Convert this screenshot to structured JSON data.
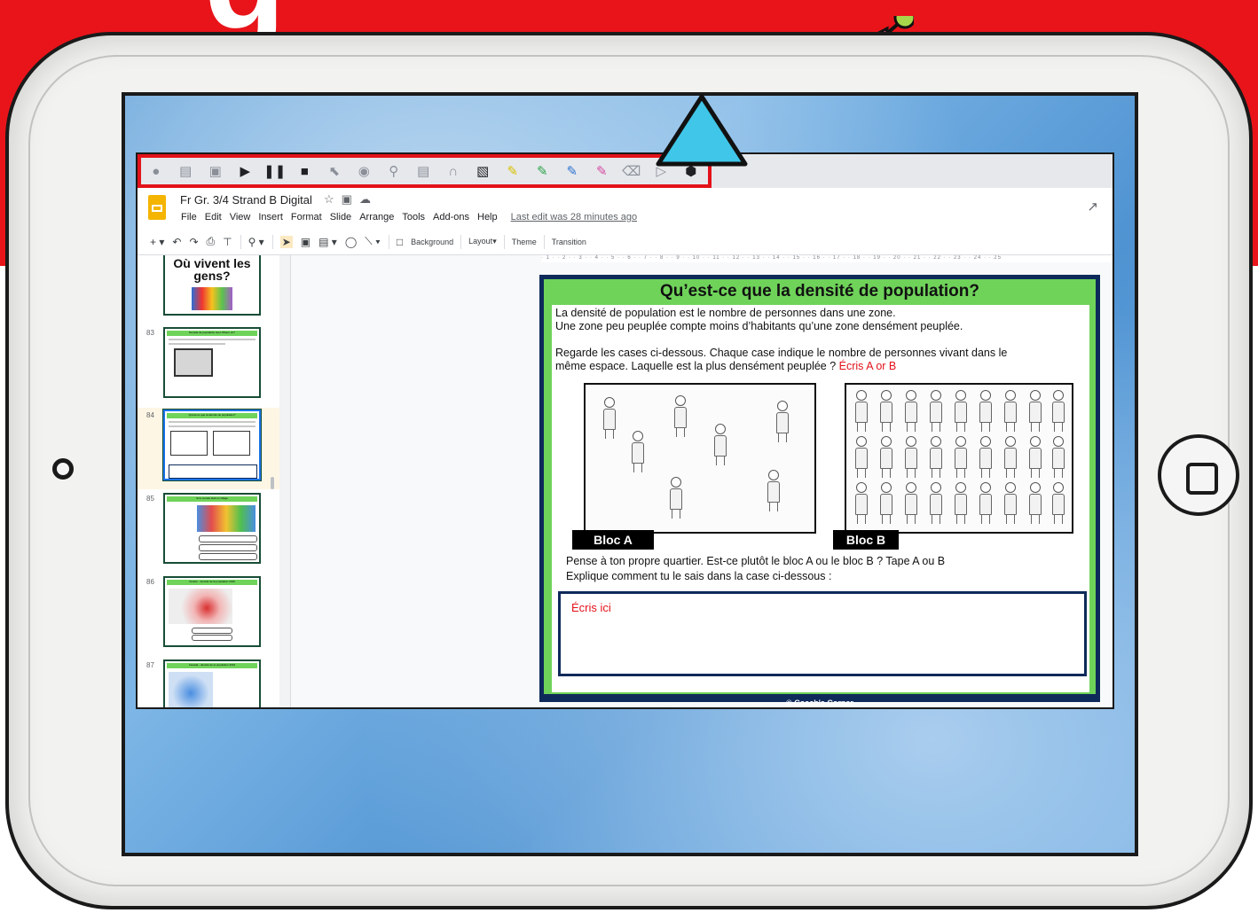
{
  "extension_toolbar": {
    "icons": [
      "speaker-icon",
      "book-icon",
      "image-icon",
      "play-icon",
      "pause-icon",
      "stop-icon",
      "select-icon",
      "speech-icon",
      "search-icon",
      "screen-icon",
      "headphones-icon",
      "translate-icon",
      "highlighter-yellow-icon",
      "highlighter-green-icon",
      "highlighter-blue-icon",
      "highlighter-pink-icon",
      "eraser-icon",
      "next-icon",
      "cube-icon"
    ]
  },
  "doc": {
    "title": "Fr Gr. 3/4 Strand B Digital",
    "menu": [
      "File",
      "Edit",
      "View",
      "Insert",
      "Format",
      "Slide",
      "Arrange",
      "Tools",
      "Add-ons",
      "Help"
    ],
    "last_edit": "Last edit was 28 minutes ago"
  },
  "toolbar": {
    "background": "Background",
    "layout": "Layout",
    "theme": "Theme",
    "transition": "Transition"
  },
  "filmstrip": {
    "first_title": "Où vivent les gens?",
    "slides": [
      {
        "num": "83",
        "title": "Densité de population avec Where on?"
      },
      {
        "num": "84",
        "title": "Qu'est-ce que la densité de population?"
      },
      {
        "num": "85",
        "title": "Si le monde était un village"
      },
      {
        "num": "86",
        "title": "Ontario - densité de la population 2016"
      },
      {
        "num": "87",
        "title": "Canada - densité de la population 2016"
      }
    ]
  },
  "ruler_h": "· 1 · · 2 · · 3 · · 4 · · 5 · · 6 · · 7 · · 8 · · 9 · · 10 · · 11 · · 12 · · 13 · · 14 · · 15 · · 16 · · 17 · · 18 · · 19 · · 20 · · 21 · · 22 · · 23 · · 24 · · 25",
  "slide": {
    "title": "Qu’est-ce que la densité de population?",
    "line1": "La densité de population est le nombre de personnes dans une zone.",
    "line2": "Une zone peu peuplée compte moins d’habitants qu’une zone densément peuplée.",
    "line3": "Regarde les cases ci-dessous. Chaque case indique le nombre de personnes vivant dans le",
    "line4a": "même espace. Laquelle est la plus densément peuplée ? ",
    "line4b": "Écris A or B",
    "bloc_a": "Bloc A",
    "bloc_b": "Bloc B",
    "line5": "Pense à ton propre quartier. Est-ce plutôt le bloc A ou le bloc B ? Tape A ou B",
    "line6": "Explique comment tu le sais dans la case ci-dessous :",
    "answer_placeholder": "Écris ici",
    "footer": "© Coach's Corner"
  },
  "colors": {
    "banner": "#e8141a",
    "highlight_frame": "#e3121a",
    "slide_green": "#6fd35a",
    "slide_navy": "#0e2a5a",
    "callout": "#3fc6e8"
  }
}
